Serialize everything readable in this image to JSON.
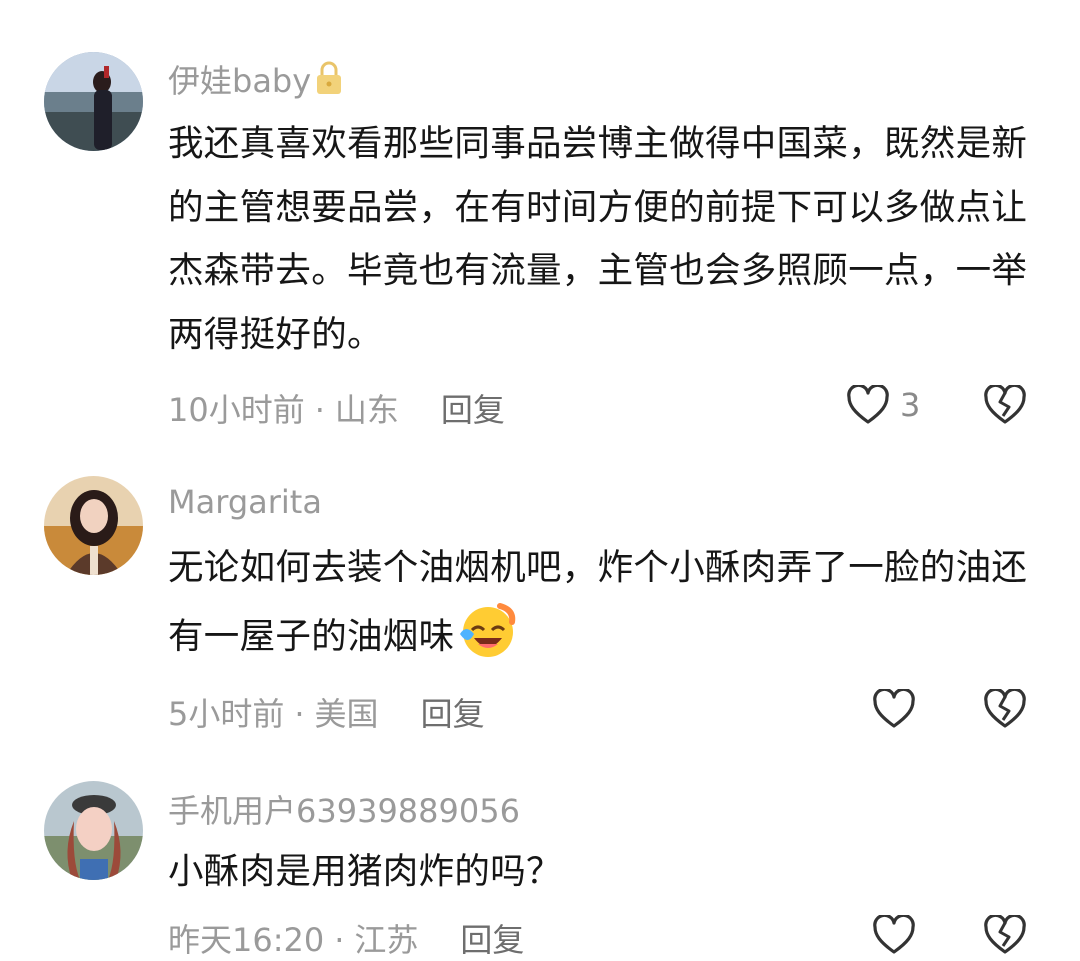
{
  "comments": [
    {
      "username": "伊娃baby",
      "content": "我还真喜欢看那些同事品尝博主做得中国菜，既然是新的主管想要品尝，在有时间方便的前提下可以多做点让杰森带去。毕竟也有流量，主管也会多照顾一点，一举两得挺好的。",
      "time": "10小时前",
      "location": "山东",
      "reply": "回复",
      "likes": "3",
      "has_lock_icon": true
    },
    {
      "username": "Margarita",
      "content": "无论如何去装个油烟机吧，炸个小酥肉弄了一脸的油还有一屋子的油烟味",
      "time": "5小时前",
      "location": "美国",
      "reply": "回复",
      "likes": ""
    },
    {
      "username": "手机用户63939889056",
      "content": "小酥肉是用猪肉炸的吗？",
      "time": "昨天16:20",
      "location": "江苏",
      "reply": "回复",
      "likes": ""
    }
  ],
  "separator": "·",
  "icons": {
    "like": "heart-outline-icon",
    "dislike": "broken-heart-outline-icon",
    "lock": "lock-icon",
    "emoji": "laughing-tears-emoji-icon"
  },
  "colors": {
    "text": "#161616",
    "meta": "#9a9a9a",
    "icon": "#333333",
    "lock": "#f2c94c"
  }
}
